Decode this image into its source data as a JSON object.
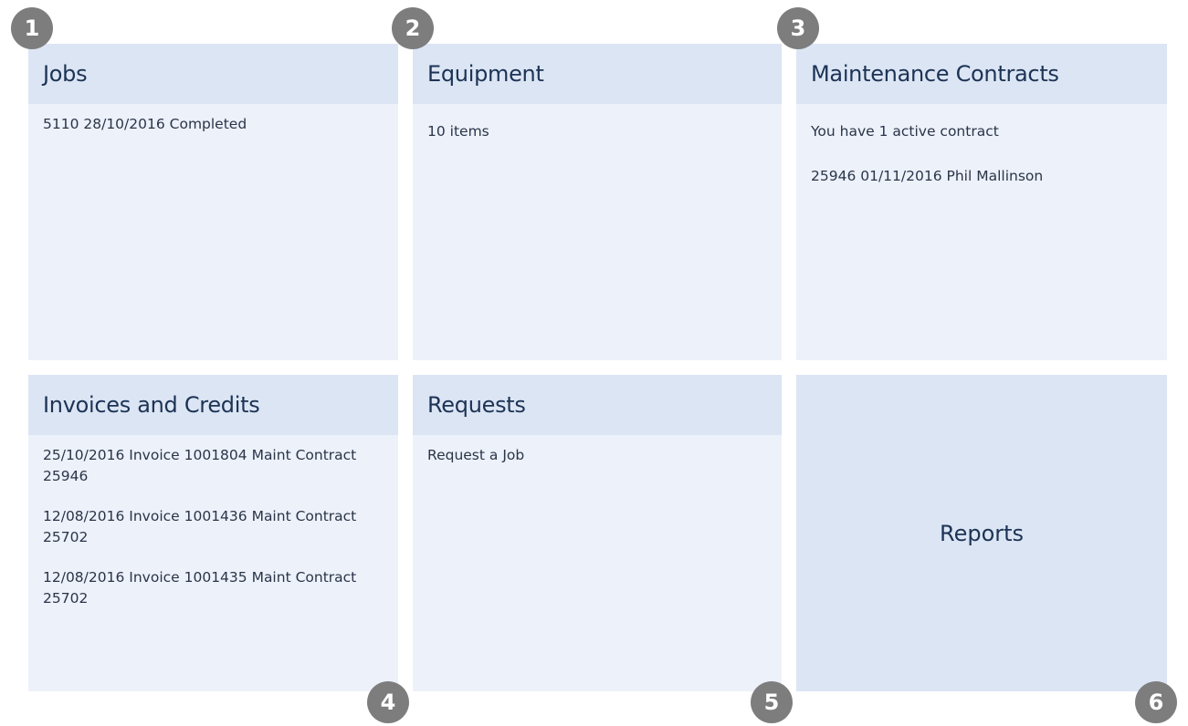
{
  "badges": [
    "1",
    "2",
    "3",
    "4",
    "5",
    "6"
  ],
  "panels": {
    "jobs": {
      "title": "Jobs",
      "items": [
        "5110 28/10/2016 Completed"
      ]
    },
    "equipment": {
      "title": "Equipment",
      "items": [
        "10 items"
      ]
    },
    "maintenance": {
      "title": "Maintenance Contracts",
      "items": [
        "You have 1 active contract",
        "25946 01/11/2016 Phil Mallinson"
      ]
    },
    "invoices": {
      "title": "Invoices and Credits",
      "items": [
        "25/10/2016 Invoice 1001804 Maint Contract 25946",
        "12/08/2016 Invoice 1001436 Maint Contract 25702",
        "12/08/2016 Invoice 1001435 Maint Contract 25702"
      ]
    },
    "requests": {
      "title": "Requests",
      "items": [
        "Request a Job"
      ]
    },
    "reports": {
      "label": "Reports"
    }
  },
  "colors": {
    "panel_bg": "#edf1fa",
    "header_bg": "#dce5f4",
    "title_text": "#1c3354",
    "body_text": "#2a3548",
    "badge_bg": "#7d7d7d"
  }
}
